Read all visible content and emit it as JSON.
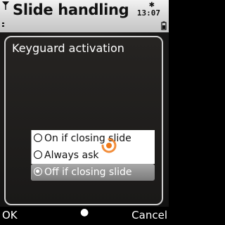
{
  "statusbar": {
    "title": "Slide handling",
    "clock": "13:07",
    "bluetooth": "✱"
  },
  "dialog": {
    "title": "Keyguard activation",
    "options": [
      {
        "label": "On if closing slide",
        "selected": false
      },
      {
        "label": "Always ask",
        "selected": false
      },
      {
        "label": "Off if closing slide",
        "selected": true
      }
    ]
  },
  "softkeys": {
    "left": "OK",
    "middle": "●",
    "right": "Cancel"
  },
  "icons": {
    "signal": "signal-icon",
    "battery": "battery-icon",
    "spinner": "loading-spinner-icon"
  },
  "colors": {
    "accent": "#f07a1a",
    "selection": "#8c8c8c"
  }
}
